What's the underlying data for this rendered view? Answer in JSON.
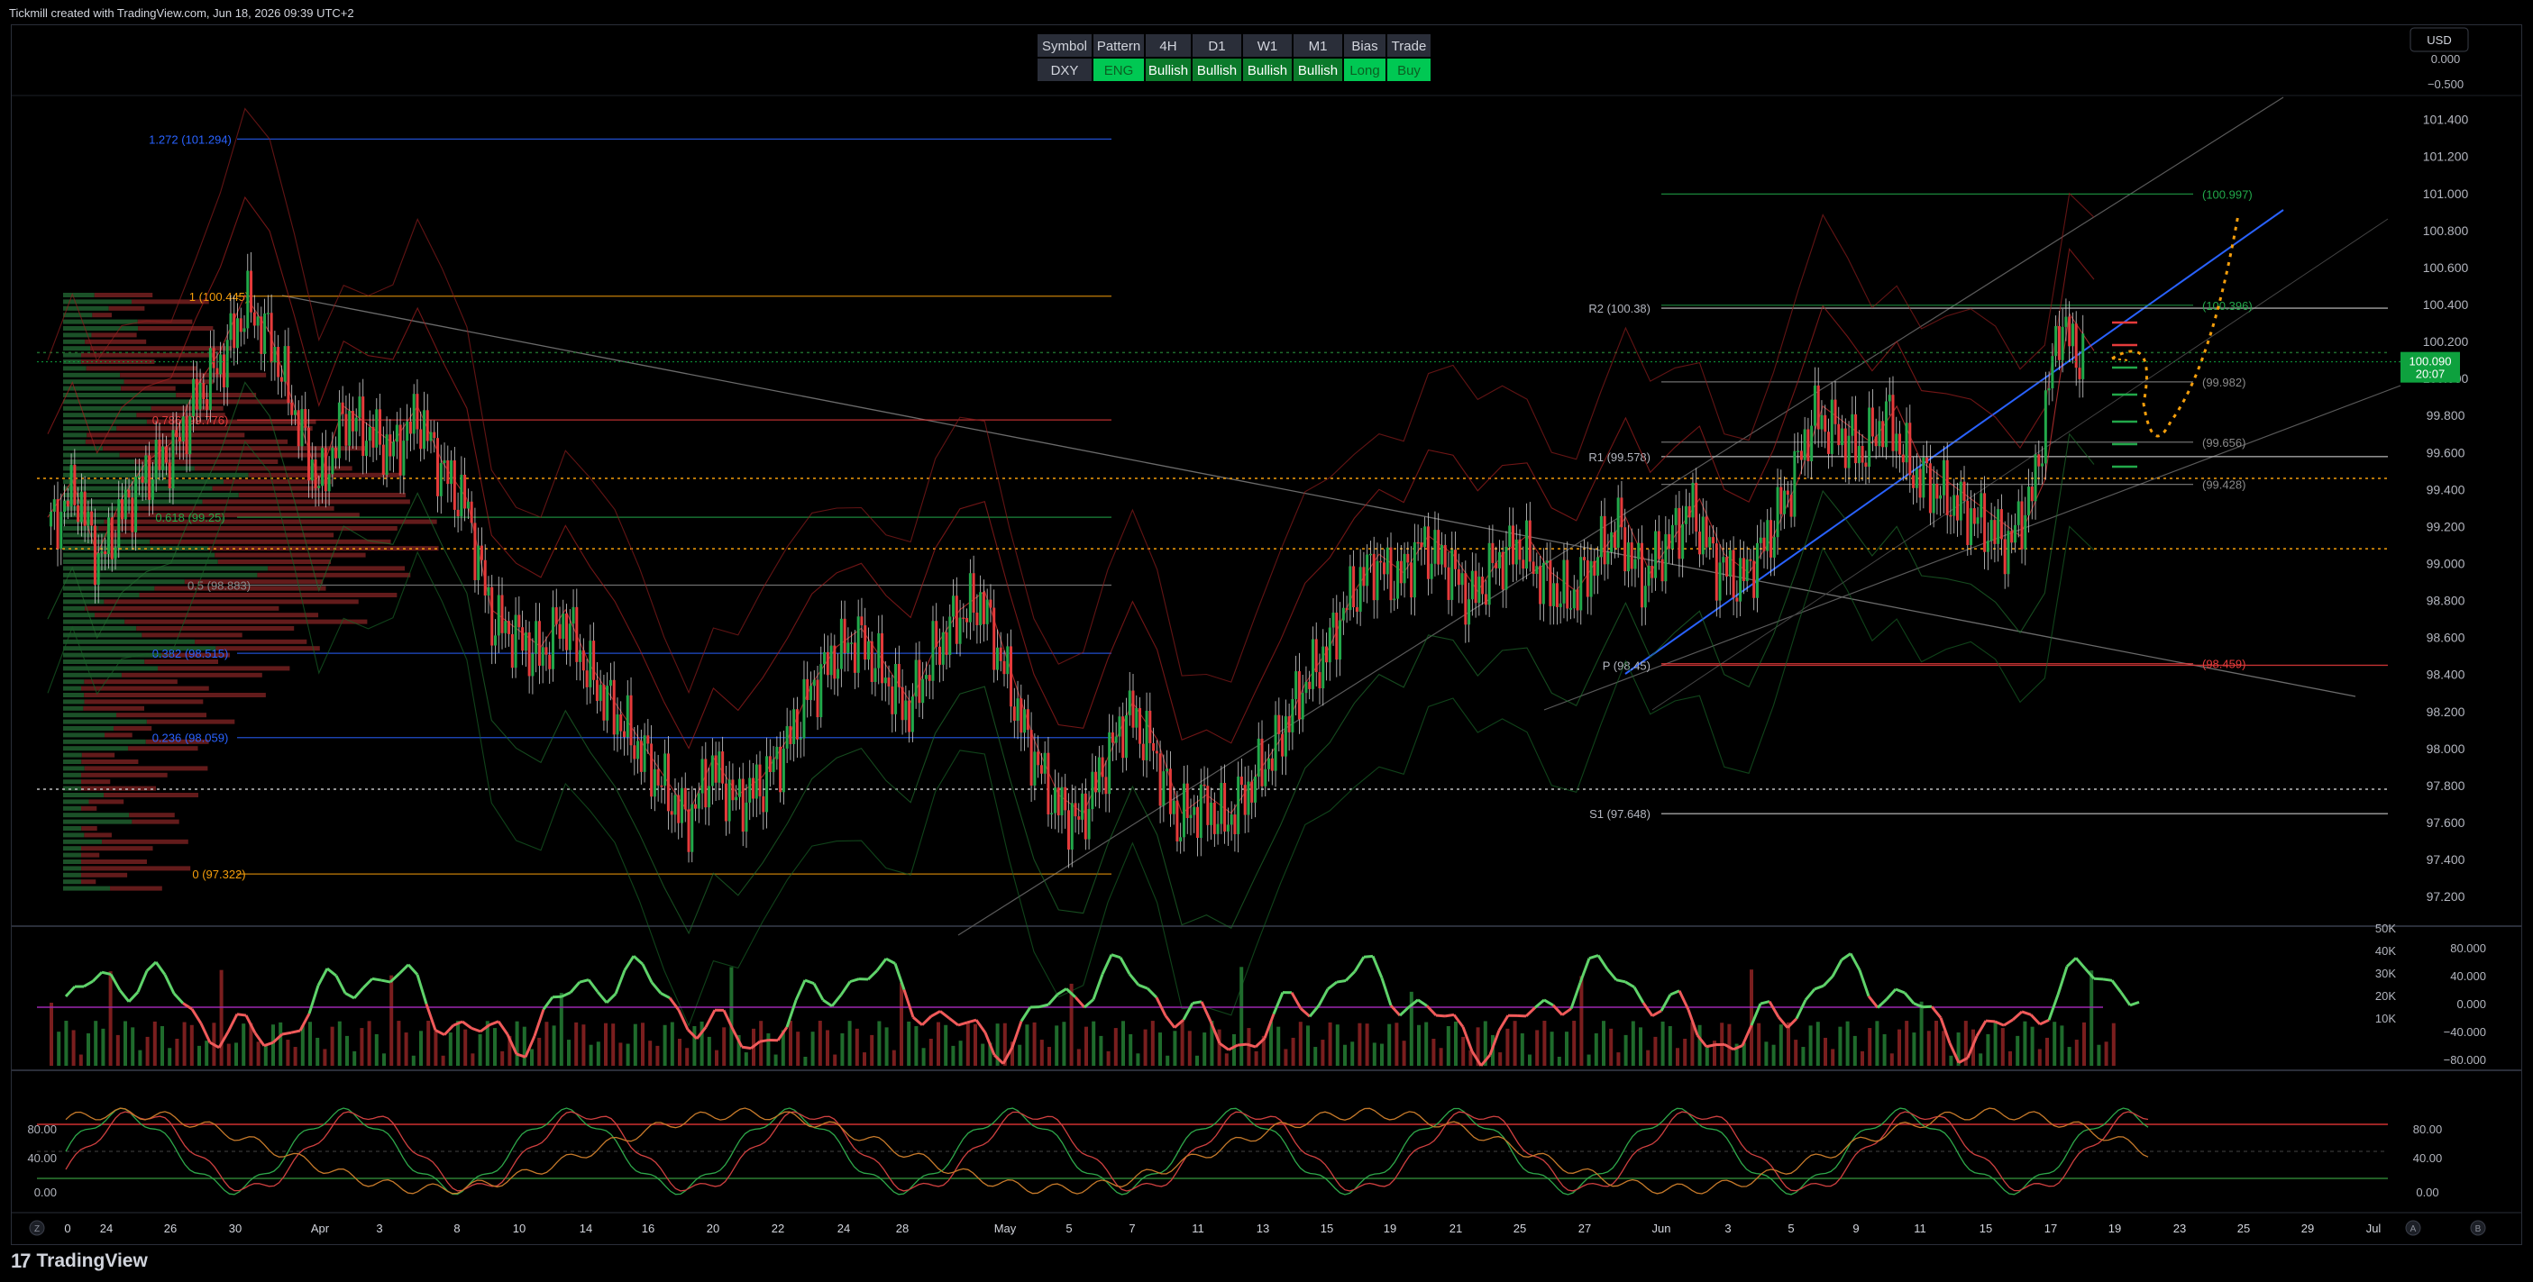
{
  "header": {
    "title": "Tickmill created with TradingView.com, Jun 18, 2026 09:39 UTC+2"
  },
  "footer": {
    "logo": "TradingView"
  },
  "currency_button": "USD",
  "colors": {
    "bull": "#22a84a",
    "bear": "#e53b3b",
    "accent": "#2962ff",
    "price_tag": "#0ea13e",
    "gray": "#8a8a8a",
    "orange": "#f59e0b",
    "purple": "#9c27b0"
  },
  "table": {
    "headers": [
      "Symbol",
      "Pattern",
      "4H",
      "D1",
      "W1",
      "M1",
      "Bias",
      "Trade"
    ],
    "values": [
      "DXY",
      "ENG",
      "Bullish",
      "Bullish",
      "Bullish",
      "Bullish",
      "Long",
      "Buy"
    ]
  },
  "price_tag": {
    "price": "100.090",
    "timer": "20:07"
  },
  "fib_labels": [
    {
      "text": "1.272 (101.294)",
      "price": 101.294,
      "color": "#2962ff"
    },
    {
      "text": "1 (100.445)",
      "price": 100.445,
      "color": "#f59e0b"
    },
    {
      "text": "0.786 (99.776)",
      "price": 99.776,
      "color": "#e53b3b"
    },
    {
      "text": "0.618 (99.25)",
      "price": 99.25,
      "color": "#22a84a"
    },
    {
      "text": "0.5 (98.883)",
      "price": 98.883,
      "color": "#8a8a8a"
    },
    {
      "text": "0.382 (98.515)",
      "price": 98.515,
      "color": "#2962ff"
    },
    {
      "text": "0.236 (98.059)",
      "price": 98.059,
      "color": "#2962ff"
    },
    {
      "text": "0 (97.322)",
      "price": 97.322,
      "color": "#f59e0b"
    }
  ],
  "pivot_labels": [
    {
      "text": "R2 (100.38)",
      "price": 100.38
    },
    {
      "text": "R1 (99.578)",
      "price": 99.578
    },
    {
      "text": "P (98.45)",
      "price": 98.45
    },
    {
      "text": "S1 (97.648)",
      "price": 97.648
    }
  ],
  "target_labels": [
    {
      "text": "(100.997)",
      "price": 100.997,
      "color": "#22a84a"
    },
    {
      "text": "(100.396)",
      "price": 100.396,
      "color": "#22a84a"
    },
    {
      "text": "(99.982)",
      "price": 99.982,
      "color": "#8a8a8a"
    },
    {
      "text": "(99.656)",
      "price": 99.656,
      "color": "#8a8a8a"
    },
    {
      "text": "(99.428)",
      "price": 99.428,
      "color": "#8a8a8a"
    },
    {
      "text": "(98.459)",
      "price": 98.459,
      "color": "#e53b3b"
    }
  ],
  "chart_data": {
    "type": "candlestick",
    "symbol": "DXY",
    "y_axis_ticks": [
      "101.400",
      "101.200",
      "101.000",
      "100.800",
      "100.600",
      "100.400",
      "100.200",
      "100.000",
      "99.800",
      "99.600",
      "99.400",
      "99.200",
      "99.000",
      "98.800",
      "98.600",
      "98.400",
      "98.200",
      "98.000",
      "97.800",
      "97.600",
      "97.400",
      "97.200"
    ],
    "ylim": [
      97.04,
      101.52
    ],
    "top_right_ticks": [
      "0.000",
      "−0.500"
    ],
    "x_axis_ticks": [
      "0",
      "24",
      "26",
      "30",
      "Apr",
      "3",
      "8",
      "10",
      "14",
      "16",
      "20",
      "22",
      "24",
      "28",
      "May",
      "5",
      "7",
      "11",
      "13",
      "15",
      "19",
      "21",
      "25",
      "27",
      "Jun",
      "3",
      "5",
      "9",
      "11",
      "15",
      "17",
      "19",
      "23",
      "25",
      "29",
      "Jul"
    ],
    "x_axis_extra": [
      "Z",
      "A",
      "B"
    ],
    "price_path": [
      99.2,
      99.4,
      99.0,
      99.3,
      99.5,
      99.6,
      99.9,
      100.1,
      100.4,
      100.2,
      99.8,
      99.4,
      99.8,
      99.7,
      99.6,
      99.8,
      99.5,
      99.3,
      98.7,
      98.6,
      98.5,
      98.7,
      98.4,
      98.2,
      98.0,
      97.8,
      97.6,
      97.9,
      97.7,
      97.8,
      98.0,
      98.3,
      98.5,
      98.6,
      98.4,
      98.2,
      98.5,
      98.7,
      98.8,
      98.4,
      98.0,
      97.7,
      97.6,
      97.9,
      98.2,
      98.0,
      97.6,
      97.7,
      97.6,
      97.8,
      98.0,
      98.3,
      98.5,
      98.8,
      99.0,
      98.9,
      99.1,
      99.0,
      98.8,
      99.0,
      99.1,
      98.9,
      98.8,
      99.0,
      99.2,
      98.9,
      99.1,
      99.3,
      99.0,
      98.9,
      99.1,
      99.4,
      99.8,
      99.7,
      99.6,
      99.8,
      99.5,
      99.4,
      99.3,
      99.2,
      99.1,
      99.4,
      100.3,
      100.1
    ],
    "volume_axis_ticks": [
      "50K",
      "40K",
      "30K",
      "20K",
      "10K"
    ],
    "cci_axis_ticks": [
      "80.000",
      "40.000",
      "0.000",
      "−40.000",
      "−80.000"
    ],
    "stoch_axis_ticks": [
      "80.00",
      "40.00",
      "0.00"
    ],
    "stoch_right_ticks": [
      "80.00",
      "40.00",
      "0.00"
    ]
  }
}
